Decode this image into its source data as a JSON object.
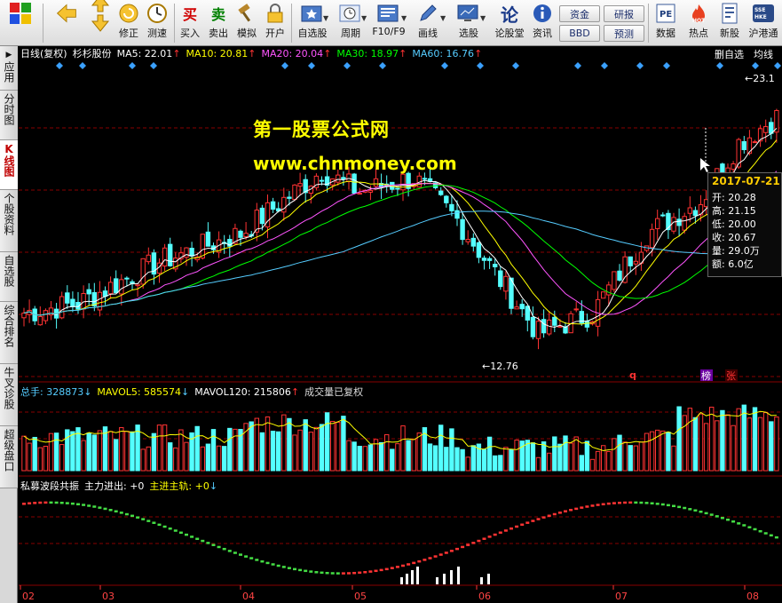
{
  "toolbar": {
    "items": [
      {
        "label": "",
        "icon": "windows-grid-icon"
      },
      {
        "label": "",
        "icon": "back-arrow-icon"
      },
      {
        "label": "",
        "icon": "up-down-arrow-icon"
      },
      {
        "label": "修正",
        "icon": "revise-icon"
      },
      {
        "label": "测速",
        "icon": "speed-test-icon"
      },
      {
        "label": "买入",
        "glyph": "买",
        "color": "#d00000"
      },
      {
        "label": "卖出",
        "glyph": "卖",
        "color": "#008000"
      },
      {
        "label": "模拟",
        "icon": "gavel-icon"
      },
      {
        "label": "开户",
        "icon": "lock-icon"
      },
      {
        "label": "自选股",
        "icon": "star-folder-icon"
      },
      {
        "label": "周期",
        "icon": "clock-icon"
      },
      {
        "label": "F10/F9",
        "icon": "f10-icon"
      },
      {
        "label": "画线",
        "icon": "pencil-icon"
      },
      {
        "label": "选股",
        "icon": "monitor-icon"
      },
      {
        "label": "论股堂",
        "glyph": "论",
        "color": "#1a3a8a"
      },
      {
        "label": "资讯",
        "icon": "info-icon"
      },
      {
        "label": "数据",
        "icon": "pe-data-icon"
      },
      {
        "label": "热点",
        "icon": "hot-icon"
      },
      {
        "label": "新股",
        "icon": "new-stock-icon"
      },
      {
        "label": "沪港通",
        "icon": "hk-connect-icon"
      }
    ],
    "small_buttons": [
      "资金",
      "BBD",
      "研报",
      "预测"
    ]
  },
  "sidebar": [
    "应用",
    "分时图",
    "K线图",
    "个股资料",
    "自选股",
    "综合排名",
    "牛叉诊股",
    "超级盘口"
  ],
  "sidebar_active": "K线图",
  "info_line": {
    "period": "日线(复权)",
    "stock": "杉杉股份",
    "ma": [
      {
        "label": "MA5: 22.01",
        "color": "#ffffff"
      },
      {
        "label": "MA10: 20.81",
        "color": "#ffff00"
      },
      {
        "label": "MA20: 20.04",
        "color": "#ff55ff"
      },
      {
        "label": "MA30: 18.97",
        "color": "#00ff00"
      },
      {
        "label": "MA60: 16.76",
        "color": "#55ccff"
      }
    ],
    "right_buttons": [
      "删自选",
      "均线"
    ]
  },
  "watermark": {
    "line1": "第一股票公式网",
    "line2": "www.chnmoney.com"
  },
  "tooltip": {
    "date": "2017-07-21",
    "open": "开: 20.28",
    "high": "高: 21.15",
    "low": "低: 20.00",
    "close": "收: 20.67",
    "volume": "量: 29.0万",
    "amount": "额: 6.0亿"
  },
  "annotations": {
    "high": "23.1",
    "low": "12.76",
    "marks": [
      "q",
      "榜",
      "张"
    ]
  },
  "volume_panel": {
    "title": "总手: 328873",
    "mavol5": "MAVOL5: 585574",
    "mavol120": "MAVOL120: 215806",
    "note": "成交量已复权"
  },
  "indicator_panel": {
    "title": "私募波段共振",
    "main_flow": "主力进出: +0",
    "main_track": "主进主轨: +0"
  },
  "x_axis": [
    "02",
    "03",
    "04",
    "05",
    "06",
    "07",
    "08"
  ],
  "colors": {
    "up": "#ff3333",
    "down": "#54ffff",
    "grid": "#880000"
  }
}
